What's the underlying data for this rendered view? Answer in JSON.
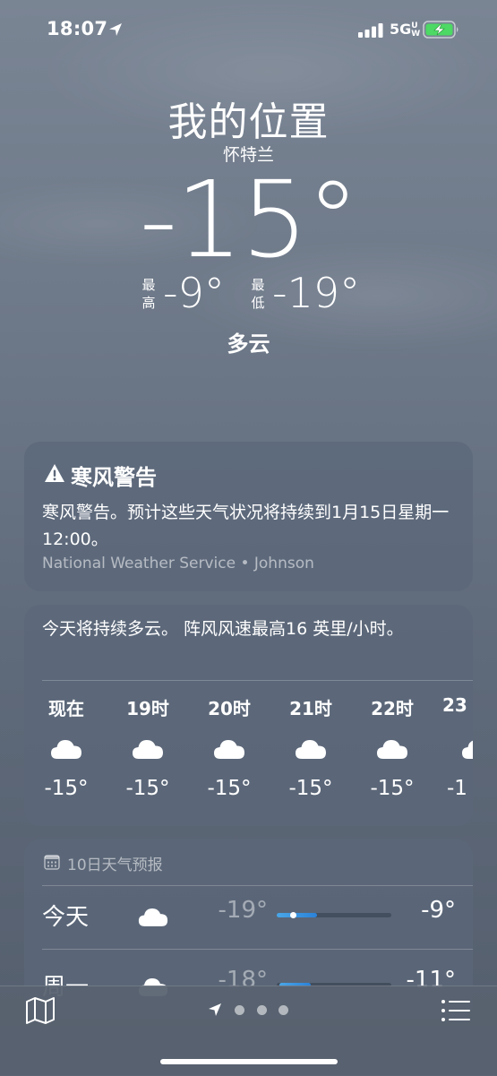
{
  "status": {
    "time": "18:07",
    "network": "5G",
    "network_suffix": "UW"
  },
  "location": {
    "title": "我的位置",
    "subtitle": "怀特兰"
  },
  "current": {
    "temp": "-15°",
    "high_label": "最高",
    "high": "-9°",
    "low_label": "最低",
    "low": "-19°",
    "condition": "多云"
  },
  "alert": {
    "title": "寒风警告",
    "body": "寒风警告。预计这些天气状况将持续到1月15日星期一12:00。",
    "source": "National Weather Service • Johnson"
  },
  "hourly": {
    "summary": "今天将持续多云。 阵风风速最高16 英里/小时。",
    "items": [
      {
        "label": "现在",
        "icon": "cloud-icon",
        "temp": "-15°"
      },
      {
        "label": "19时",
        "icon": "cloud-icon",
        "temp": "-15°"
      },
      {
        "label": "20时",
        "icon": "cloud-icon",
        "temp": "-15°"
      },
      {
        "label": "21时",
        "icon": "cloud-icon",
        "temp": "-15°"
      },
      {
        "label": "22时",
        "icon": "cloud-icon",
        "temp": "-15°"
      },
      {
        "label": "23",
        "icon": "cloud-icon",
        "temp": "-1"
      }
    ]
  },
  "daily": {
    "header": "10日天气预报",
    "days": [
      {
        "day": "今天",
        "icon": "cloud-icon",
        "low": "-19°",
        "high": "-9°",
        "range_start": 0.0,
        "range_end": 0.35,
        "current_marker": 0.14
      },
      {
        "day": "周一",
        "icon": "cloud-icon",
        "low": "-18°",
        "high": "-11°",
        "range_start": 0.02,
        "range_end": 0.3
      }
    ]
  },
  "colors": {
    "bar_fill": "#2b82d9",
    "card_bg": "#5c687a"
  }
}
